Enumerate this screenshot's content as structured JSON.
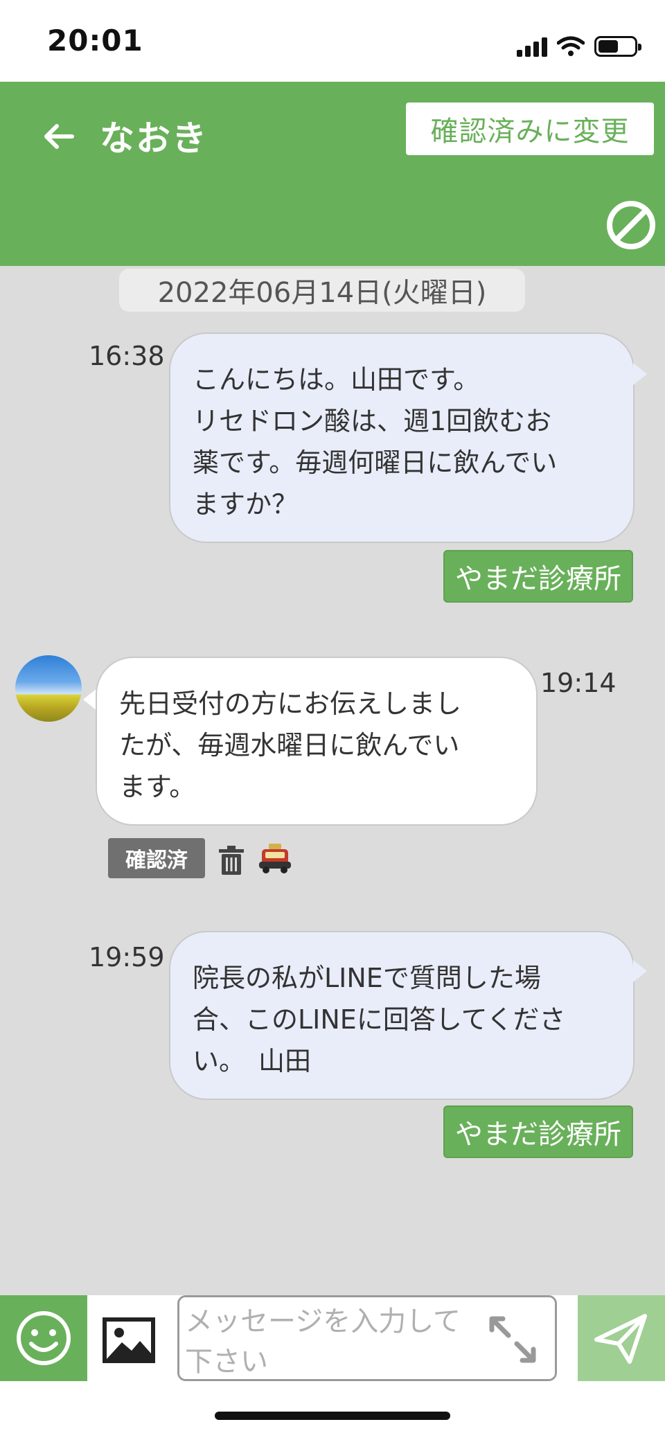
{
  "status_bar": {
    "time": "20:01"
  },
  "header": {
    "title": "なおき",
    "confirm_button_label": "確認済みに変更"
  },
  "chat": {
    "date_label": "2022年06月14日(火曜日)",
    "messages": [
      {
        "direction": "outgoing",
        "time": "16:38",
        "lines": [
          "こんにちは。山田です。",
          "リセドロン酸は、週1回飲むお",
          "薬です。毎週何曜日に飲んでい",
          "ますか？"
        ],
        "sender": "やまだ診療所"
      },
      {
        "direction": "incoming",
        "time": "19:14",
        "lines": [
          "先日受付の方にお伝えしまし",
          "たが、毎週水曜日に飲んでい",
          "ます。"
        ],
        "badge": "確認済"
      },
      {
        "direction": "outgoing",
        "time": "19:59",
        "lines": [
          "院長の私がLINEで質問した場",
          "合、このLINEに回答してくださ",
          "い。　山田"
        ],
        "sender": "やまだ診療所"
      }
    ]
  },
  "input": {
    "placeholder": "メッセージを入力して下さい"
  },
  "icons": {
    "back": "arrow-left-icon",
    "block": "block-icon",
    "trash": "trash-icon",
    "notify": "car-icon",
    "emoji": "smiley-icon",
    "image": "image-icon",
    "expand": "expand-icon",
    "send": "send-icon"
  },
  "colors": {
    "brand_green": "#69b05a",
    "send_green_light": "#9fcf93",
    "chat_background": "#dcdcdc",
    "outgoing_bubble": "#e8edf9",
    "incoming_bubble": "#ffffff",
    "badge_gray": "#707070"
  }
}
